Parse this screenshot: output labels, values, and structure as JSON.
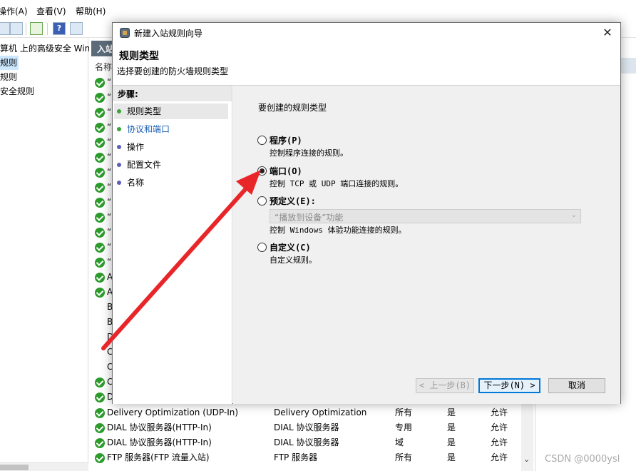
{
  "menu": [
    "操作(A)",
    "查看(V)",
    "帮助(H)"
  ],
  "left_tree": [
    "算机 上的高级安全 Wind",
    "规则",
    "规则",
    "安全规则"
  ],
  "list": {
    "title": "入站",
    "col_name": "名称",
    "rows_partial": [
      "“",
      "“",
      "“",
      "“",
      "“",
      "“",
      "“",
      "“",
      "“",
      "“",
      "“",
      "“",
      "“",
      "A",
      "A",
      "B",
      "B",
      "D",
      "C",
      "C",
      "C",
      "D"
    ],
    "rows": [
      {
        "name": "Delivery Optimization (UDP-In)",
        "group": "Delivery Optimization",
        "profile": "所有",
        "enabled": "是",
        "action": "允许"
      },
      {
        "name": "DIAL 协议服务器(HTTP-In)",
        "group": "DIAL 协议服务器",
        "profile": "专用",
        "enabled": "是",
        "action": "允许"
      },
      {
        "name": "DIAL 协议服务器(HTTP-In)",
        "group": "DIAL 协议服务器",
        "profile": "域",
        "enabled": "是",
        "action": "允许"
      },
      {
        "name": "FTP 服务器(FTP 流量入站)",
        "group": "FTP 服务器",
        "profile": "所有",
        "enabled": "是",
        "action": "允许"
      }
    ]
  },
  "dialog": {
    "title": "新建入站规则向导",
    "page_title": "规则类型",
    "page_subtitle": "选择要创建的防火墙规则类型",
    "steps_header": "步骤:",
    "steps": [
      "规则类型",
      "协议和端口",
      "操作",
      "配置文件",
      "名称"
    ],
    "question": "要创建的规则类型",
    "options": [
      {
        "label": "程序(P)",
        "desc": "控制程序连接的规则。",
        "selected": false
      },
      {
        "label": "端口(O)",
        "desc": "控制 TCP 或 UDP 端口连接的规则。",
        "selected": true
      },
      {
        "label": "预定义(E):",
        "desc": "控制 Windows 体验功能连接的规则。",
        "selected": false
      },
      {
        "label": "自定义(C)",
        "desc": "自定义规则。",
        "selected": false
      }
    ],
    "predefined_select": "“播放到设备”功能",
    "buttons": {
      "back": "< 上一步(B)",
      "next": "下一步(N) >",
      "cancel": "取消"
    },
    "close": "✕"
  },
  "annotation_color": "#e8262a",
  "watermark": "CSDN @0000ysl"
}
